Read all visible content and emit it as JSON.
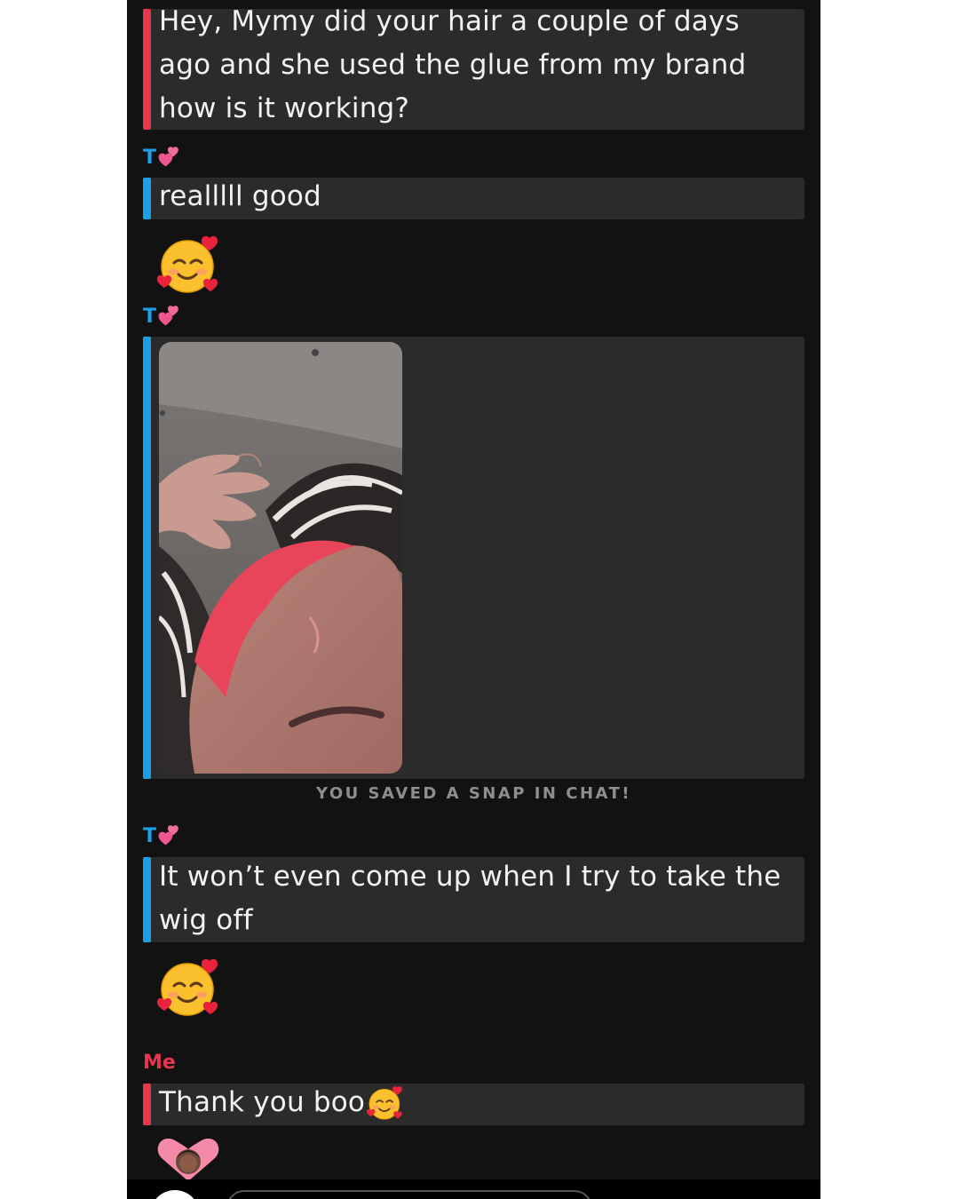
{
  "chat": {
    "messages": [
      {
        "sender": "Me",
        "text": "Hey, Mymy did your hair a couple of days ago and she used the glue from my brand how is it working?"
      },
      {
        "sender": "T",
        "text": "realllll good"
      },
      {
        "sender": "T",
        "type": "snap"
      },
      {
        "sender": "T",
        "text": "It won’t even come up when I try to take the wig off"
      },
      {
        "sender": "Me",
        "text": "Thank you boo"
      }
    ],
    "sender_t": "T",
    "sender_me": "Me",
    "saved_note": "YOU SAVED A SNAP IN CHAT!",
    "emoji_reaction": "smiling-face-with-hearts-icon",
    "bitmoji": "bitmoji-heart-icon"
  },
  "colors": {
    "me": "#e8364f",
    "friend": "#1b9fe6",
    "background": "#121212",
    "bubble": "#2b2b2b"
  }
}
